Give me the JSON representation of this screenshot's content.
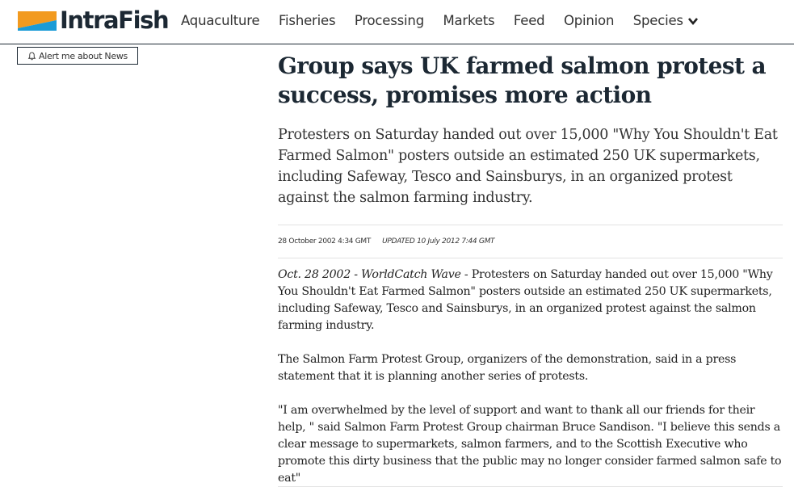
{
  "header": {
    "logo_text": "IntraFish",
    "logo_colors": {
      "orange": "#f29a1f",
      "blue": "#1a9bd7",
      "dark": "#1c2833"
    },
    "nav": [
      {
        "label": "Aquaculture"
      },
      {
        "label": "Fisheries"
      },
      {
        "label": "Processing"
      },
      {
        "label": "Markets"
      },
      {
        "label": "Feed"
      },
      {
        "label": "Opinion"
      },
      {
        "label": "Species"
      }
    ]
  },
  "alert": {
    "label": "Alert me about News",
    "icon": "bell-icon"
  },
  "article": {
    "title": "Group says UK farmed salmon protest a success, promises more action",
    "lead": "Protesters on Saturday handed out over 15,000 \"Why You Shouldn't Eat Farmed Salmon\" posters outside an estimated 250 UK supermarkets, including Safeway, Tesco and Sainsburys, in an organized protest against the salmon farming industry.",
    "published": "28 October 2002 4:34 GMT",
    "updated": "UPDATED  10 July 2012 7:44 GMT",
    "paragraphs": [
      {
        "dateline": "Oct. 28 2002 - WorldCatch Wave",
        "text": " - Protesters on Saturday handed out over 15,000 \"Why You Shouldn't Eat Farmed Salmon\" posters outside an estimated 250 UK supermarkets, including Safeway, Tesco and Sainsburys, in an organized protest against the salmon farming industry."
      },
      {
        "text": "The Salmon Farm Protest Group, organizers of the demonstration, said in a press statement that it is planning another series of protests."
      },
      {
        "text": "\"I am overwhelmed by the level of support and want to thank all our friends for their help, \" said Salmon Farm Protest Group chairman Bruce Sandison. \"I believe this sends a clear message to supermarkets, salmon farmers, and to the Scottish Executive who promote this dirty business that the public may no longer consider farmed salmon safe to eat\""
      }
    ]
  }
}
